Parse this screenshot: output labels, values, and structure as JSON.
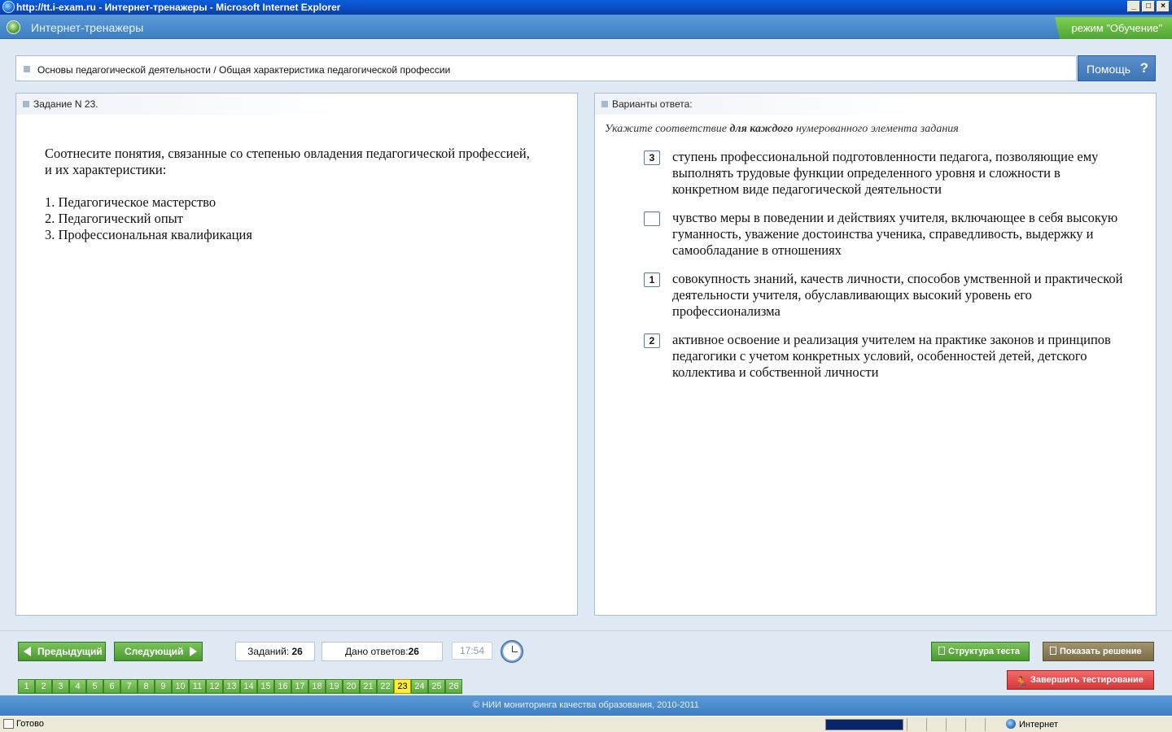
{
  "window": {
    "title": "http://tt.i-exam.ru - Интернет-тренажеры - Microsoft Internet Explorer",
    "min": "_",
    "max": "□",
    "close": "×"
  },
  "app": {
    "title": "Интернет-тренажеры",
    "mode": "режим \"Обучение\""
  },
  "breadcrumb": "Основы педагогической деятельности / Общая характеристика педагогической профессии",
  "help": {
    "label": "Помощь",
    "icon": "?"
  },
  "task": {
    "header": "Задание N 23.",
    "text": "Соотнесите понятия, связанные со степенью овладения педагогической профессией, и их характеристики:",
    "items": [
      "1. Педагогическое мастерство",
      "2. Педагогический опыт",
      "3. Профессиональная квалификация"
    ]
  },
  "answers": {
    "header": "Варианты ответа:",
    "instruction_pre": "Укажите соответствие ",
    "instruction_bold": "для каждого",
    "instruction_post": " нумерованного элемента задания",
    "options": [
      {
        "value": "3",
        "text": "ступень профессиональной подготовленности педагога, позволяющие ему выполнять трудовые функции определенного уровня и сложности в конкретном виде педагогической деятельности"
      },
      {
        "value": "",
        "text": "чувство меры в поведении и действиях учителя, включающее в себя высокую гуманность, уважение достоинства ученика, справедливость, выдержку и самообладание в отношениях"
      },
      {
        "value": "1",
        "text": "совокупность знаний, качеств личности, способов умственной и практической деятельности учителя, обуславливающих высокий уровень его профессионализма"
      },
      {
        "value": "2",
        "text": "активное освоение и реализация учителем на практике законов и принципов педагогики с учетом конкретных условий, особенностей детей, детского коллектива и собственной личности"
      }
    ]
  },
  "nav": {
    "prev": "Предыдущий",
    "next": "Следующий",
    "tasks_label": "Заданий:",
    "tasks_count": "26",
    "answered_label": "Дано ответов:",
    "answered_count": "26",
    "timer": "17:54",
    "structure": "Структура теста",
    "show_solution": "Показать решение",
    "finish": "Завершить тестирование",
    "pages": [
      "1",
      "2",
      "3",
      "4",
      "5",
      "6",
      "7",
      "8",
      "9",
      "10",
      "11",
      "12",
      "13",
      "14",
      "15",
      "16",
      "17",
      "18",
      "19",
      "20",
      "21",
      "22",
      "23",
      "24",
      "25",
      "26"
    ],
    "current_page": "23"
  },
  "footer": "© НИИ мониторинга качества образования, 2010-2011",
  "status": {
    "text": "Готово",
    "zone": "Интернет"
  },
  "colors": {
    "accent": "#3d7fc4",
    "button_green": "#5aa93d",
    "finish_red": "#d43636",
    "current_page": "#ffee33"
  }
}
